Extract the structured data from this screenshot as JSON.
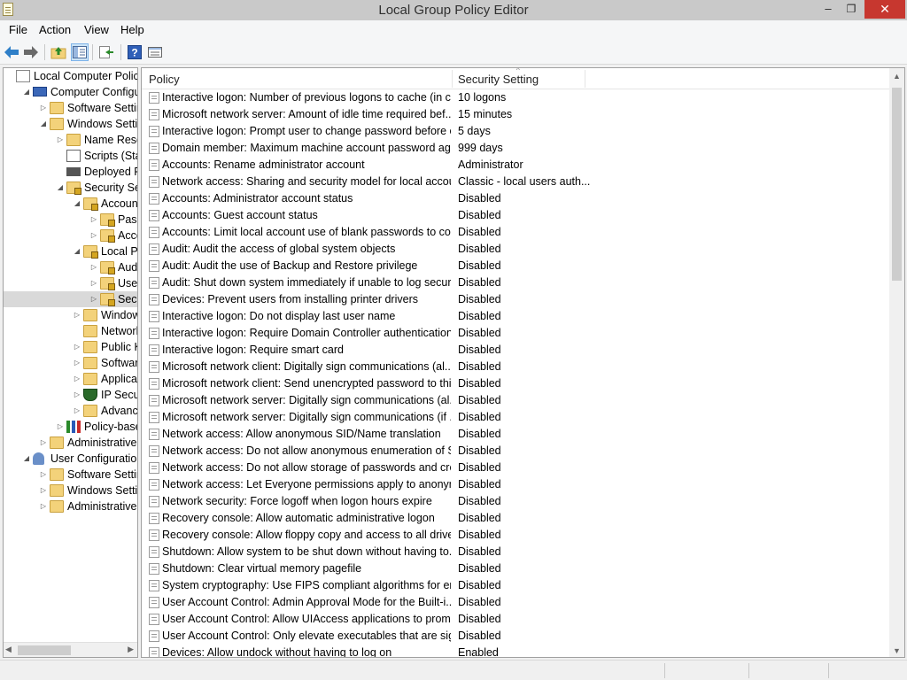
{
  "window": {
    "title": "Local Group Policy Editor",
    "minimize_glyph": "–",
    "restore_glyph": "❐",
    "close_glyph": "✕"
  },
  "menu": {
    "file": "File",
    "action": "Action",
    "view": "View",
    "help": "Help"
  },
  "toolbar": {
    "back_icon": "back-arrow-icon",
    "forward_icon": "forward-arrow-icon",
    "up_icon": "up-folder-icon",
    "show_hide_tree_icon": "show-hide-console-tree-icon",
    "export_icon": "export-list-icon",
    "help_icon": "help-icon",
    "help_glyph": "?",
    "properties_icon": "properties-icon"
  },
  "tree": {
    "items": [
      {
        "label": "Local Computer Policy",
        "expander": "",
        "icon": "policy-doc-icon"
      },
      {
        "label": "Computer Configura",
        "expander": "◢",
        "icon": "computer-icon"
      },
      {
        "label": "Software Settings",
        "expander": "▷",
        "icon": "folder-icon"
      },
      {
        "label": "Windows Setting",
        "expander": "◢",
        "icon": "folder-icon"
      },
      {
        "label": "Name Resolu",
        "expander": "▷",
        "icon": "folder-icon"
      },
      {
        "label": "Scripts (Startu",
        "expander": "",
        "icon": "scripts-icon"
      },
      {
        "label": "Deployed Prin",
        "expander": "",
        "icon": "printer-icon"
      },
      {
        "label": "Security Settin",
        "expander": "◢",
        "icon": "security-icon"
      },
      {
        "label": "Account P",
        "expander": "◢",
        "icon": "locked-folder-icon"
      },
      {
        "label": "Passw",
        "expander": "▷",
        "icon": "locked-folder-icon"
      },
      {
        "label": "Accou",
        "expander": "▷",
        "icon": "locked-folder-icon"
      },
      {
        "label": "Local Poli",
        "expander": "◢",
        "icon": "locked-folder-icon"
      },
      {
        "label": "Audit",
        "expander": "▷",
        "icon": "locked-folder-icon"
      },
      {
        "label": "User R",
        "expander": "▷",
        "icon": "locked-folder-icon"
      },
      {
        "label": "Securi",
        "expander": "▷",
        "icon": "locked-folder-icon"
      },
      {
        "label": "Windows",
        "expander": "▷",
        "icon": "folder-icon"
      },
      {
        "label": "Network L",
        "expander": "",
        "icon": "folder-icon"
      },
      {
        "label": "Public Key",
        "expander": "▷",
        "icon": "folder-icon"
      },
      {
        "label": "Software F",
        "expander": "▷",
        "icon": "folder-icon"
      },
      {
        "label": "Applicatio",
        "expander": "▷",
        "icon": "folder-icon"
      },
      {
        "label": "IP Security",
        "expander": "▷",
        "icon": "ip-security-icon"
      },
      {
        "label": "Advanced",
        "expander": "▷",
        "icon": "folder-icon"
      },
      {
        "label": "Policy-based",
        "expander": "▷",
        "icon": "qos-chart-icon"
      },
      {
        "label": "Administrative Te",
        "expander": "▷",
        "icon": "folder-icon"
      },
      {
        "label": "User Configuration",
        "expander": "◢",
        "icon": "user-icon"
      },
      {
        "label": "Software Settings",
        "expander": "▷",
        "icon": "folder-icon"
      },
      {
        "label": "Windows Setting",
        "expander": "▷",
        "icon": "folder-icon"
      },
      {
        "label": "Administrative Te",
        "expander": "▷",
        "icon": "folder-icon"
      }
    ]
  },
  "list": {
    "columns": {
      "policy": "Policy",
      "setting": "Security Setting"
    },
    "sort_glyph": "^",
    "rows": [
      {
        "policy": "Interactive logon: Number of previous logons to cache (in c...",
        "setting": "10 logons"
      },
      {
        "policy": "Microsoft network server: Amount of idle time required bef...",
        "setting": "15 minutes"
      },
      {
        "policy": "Interactive logon: Prompt user to change password before e...",
        "setting": "5 days"
      },
      {
        "policy": "Domain member: Maximum machine account password age",
        "setting": "999 days"
      },
      {
        "policy": "Accounts: Rename administrator account",
        "setting": "Administrator"
      },
      {
        "policy": "Network access: Sharing and security model for local accou...",
        "setting": "Classic - local users auth..."
      },
      {
        "policy": "Accounts: Administrator account status",
        "setting": "Disabled"
      },
      {
        "policy": "Accounts: Guest account status",
        "setting": "Disabled"
      },
      {
        "policy": "Accounts: Limit local account use of blank passwords to co...",
        "setting": "Disabled"
      },
      {
        "policy": "Audit: Audit the access of global system objects",
        "setting": "Disabled"
      },
      {
        "policy": "Audit: Audit the use of Backup and Restore privilege",
        "setting": "Disabled"
      },
      {
        "policy": "Audit: Shut down system immediately if unable to log secur...",
        "setting": "Disabled"
      },
      {
        "policy": "Devices: Prevent users from installing printer drivers",
        "setting": "Disabled"
      },
      {
        "policy": "Interactive logon: Do not display last user name",
        "setting": "Disabled"
      },
      {
        "policy": "Interactive logon: Require Domain Controller authentication...",
        "setting": "Disabled"
      },
      {
        "policy": "Interactive logon: Require smart card",
        "setting": "Disabled"
      },
      {
        "policy": "Microsoft network client: Digitally sign communications (al...",
        "setting": "Disabled"
      },
      {
        "policy": "Microsoft network client: Send unencrypted password to thi...",
        "setting": "Disabled"
      },
      {
        "policy": "Microsoft network server: Digitally sign communications (al...",
        "setting": "Disabled"
      },
      {
        "policy": "Microsoft network server: Digitally sign communications (if ...",
        "setting": "Disabled"
      },
      {
        "policy": "Network access: Allow anonymous SID/Name translation",
        "setting": "Disabled"
      },
      {
        "policy": "Network access: Do not allow anonymous enumeration of S...",
        "setting": "Disabled"
      },
      {
        "policy": "Network access: Do not allow storage of passwords and cre...",
        "setting": "Disabled"
      },
      {
        "policy": "Network access: Let Everyone permissions apply to anonym...",
        "setting": "Disabled"
      },
      {
        "policy": "Network security: Force logoff when logon hours expire",
        "setting": "Disabled"
      },
      {
        "policy": "Recovery console: Allow automatic administrative logon",
        "setting": "Disabled"
      },
      {
        "policy": "Recovery console: Allow floppy copy and access to all drives...",
        "setting": "Disabled"
      },
      {
        "policy": "Shutdown: Allow system to be shut down without having to...",
        "setting": "Disabled"
      },
      {
        "policy": "Shutdown: Clear virtual memory pagefile",
        "setting": "Disabled"
      },
      {
        "policy": "System cryptography: Use FIPS compliant algorithms for en...",
        "setting": "Disabled"
      },
      {
        "policy": "User Account Control: Admin Approval Mode for the Built-i...",
        "setting": "Disabled"
      },
      {
        "policy": "User Account Control: Allow UIAccess applications to prom...",
        "setting": "Disabled"
      },
      {
        "policy": "User Account Control: Only elevate executables that are sign...",
        "setting": "Disabled"
      },
      {
        "policy": "Devices: Allow undock without having to log on",
        "setting": "Enabled"
      }
    ]
  },
  "scroll": {
    "left_arrow": "◀",
    "right_arrow": "▶",
    "up_arrow": "▲",
    "down_arrow": "▼"
  },
  "colors": {
    "close_button": "#c7372f",
    "folder": "#f3d27a",
    "titlebar": "#c9c9c9"
  }
}
